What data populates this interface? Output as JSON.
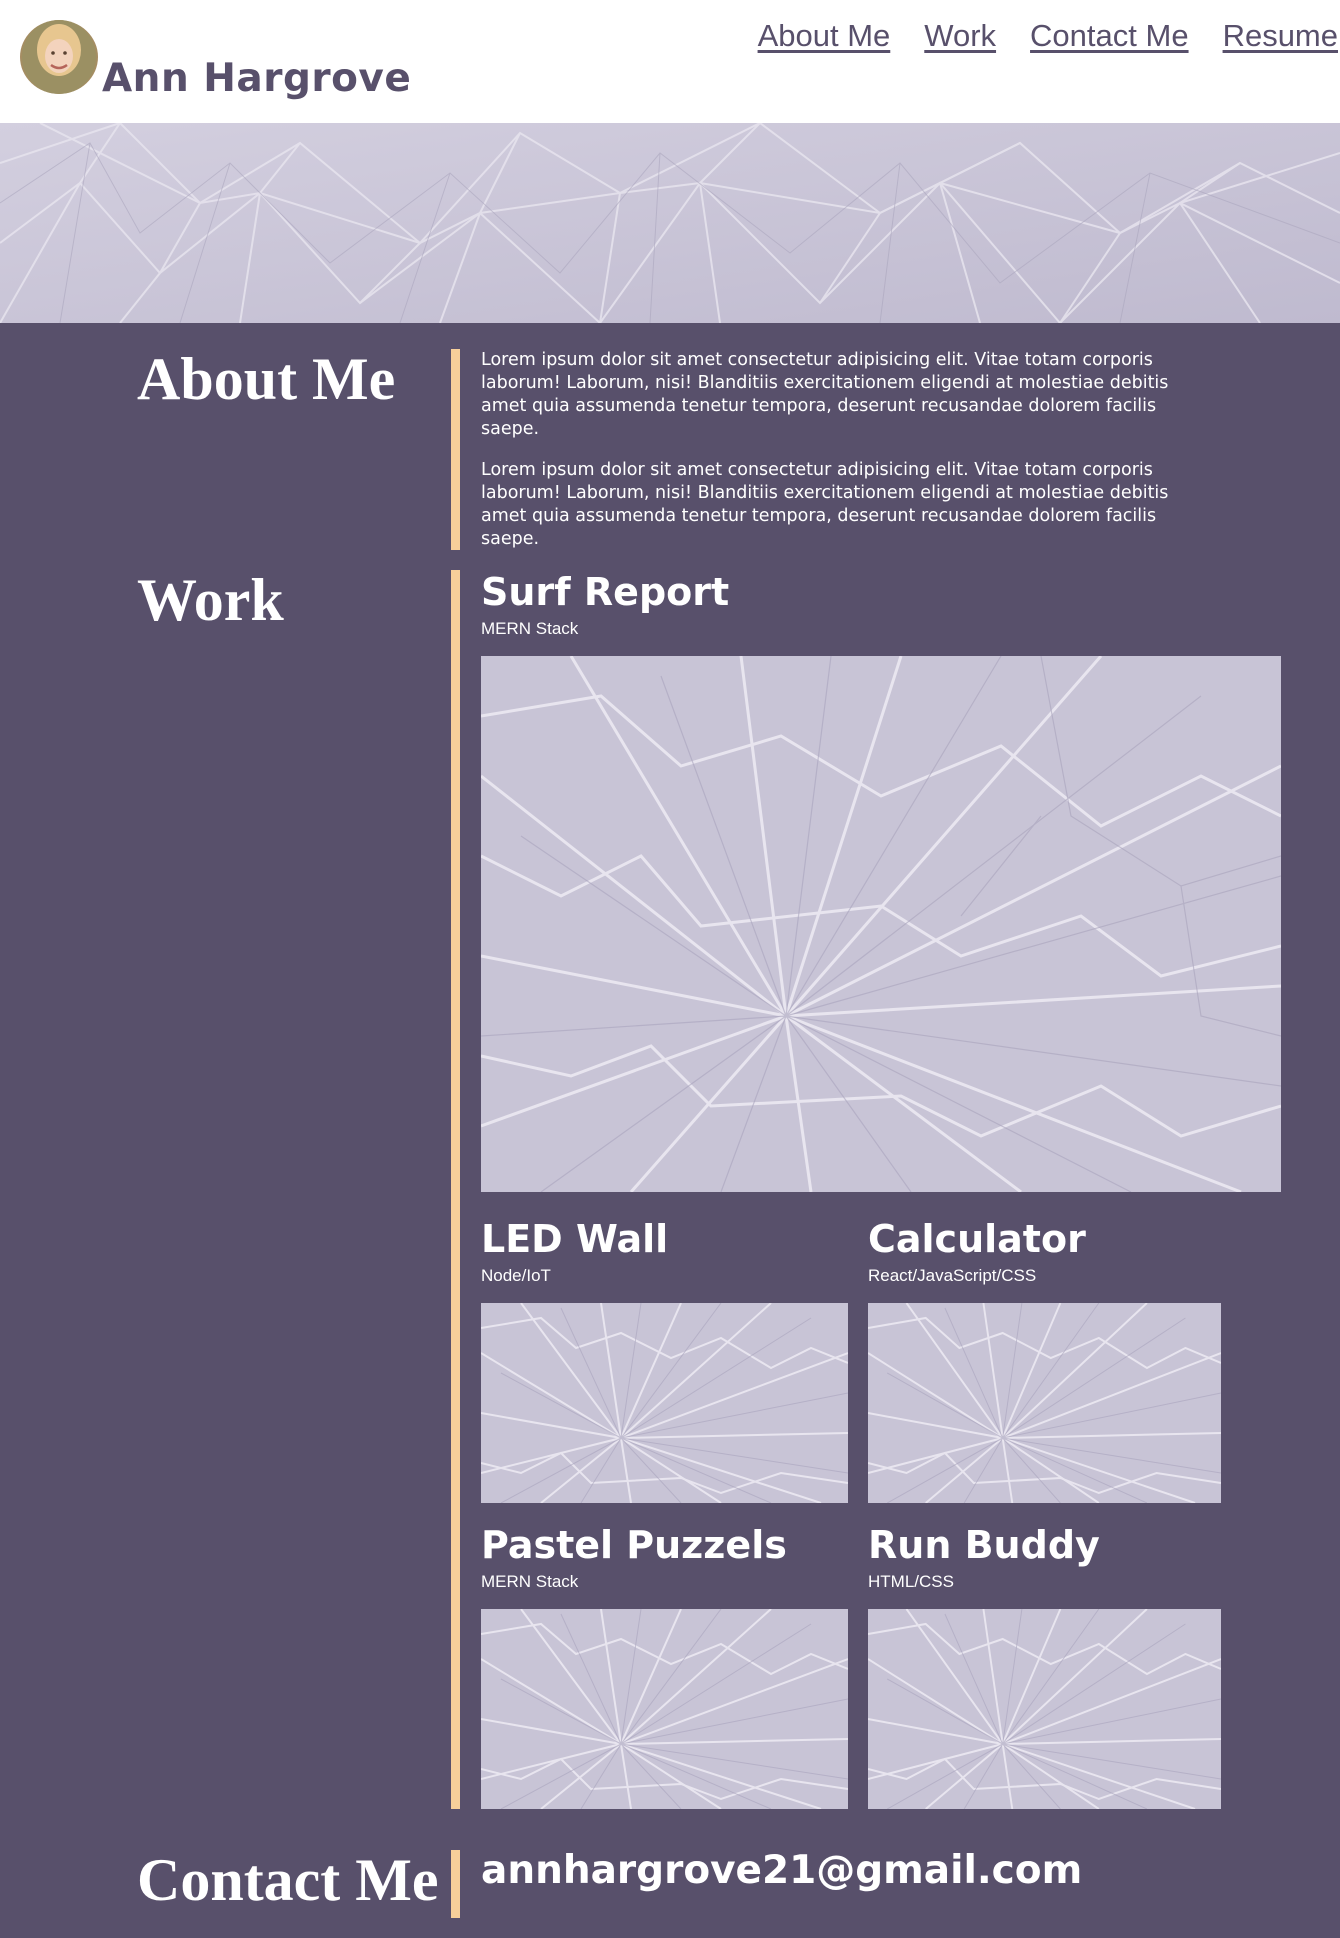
{
  "header": {
    "name": "Ann Hargrove",
    "nav": [
      "About Me",
      "Work",
      "Contact Me",
      "Resume"
    ]
  },
  "about": {
    "title": "About Me",
    "paragraphs": [
      "Lorem ipsum dolor sit amet consectetur adipisicing elit. Vitae totam corporis laborum! Laborum, nisi! Blanditiis exercitationem eligendi at molestiae debitis amet quia assumenda tenetur tempora, deserunt recusandae dolorem facilis saepe.",
      "Lorem ipsum dolor sit amet consectetur adipisicing elit. Vitae totam corporis laborum! Laborum, nisi! Blanditiis exercitationem eligendi at molestiae debitis amet quia assumenda tenetur tempora, deserunt recusandae dolorem facilis saepe."
    ]
  },
  "work": {
    "title": "Work",
    "projects": [
      {
        "name": "Surf Report",
        "stack": "MERN Stack"
      },
      {
        "name": "LED Wall",
        "stack": "Node/IoT"
      },
      {
        "name": "Calculator",
        "stack": "React/JavaScript/CSS"
      },
      {
        "name": "Pastel Puzzels",
        "stack": "MERN Stack"
      },
      {
        "name": "Run Buddy",
        "stack": "HTML/CSS"
      }
    ]
  },
  "contact": {
    "title": "Contact Me",
    "email": "annhargrove21@gmail.com"
  },
  "colors": {
    "background": "#58506b",
    "accent": "#f7cf9a",
    "header_text": "#58506b",
    "hero": "#c8c4d6"
  },
  "icons": {
    "avatar": "profile-photo"
  }
}
